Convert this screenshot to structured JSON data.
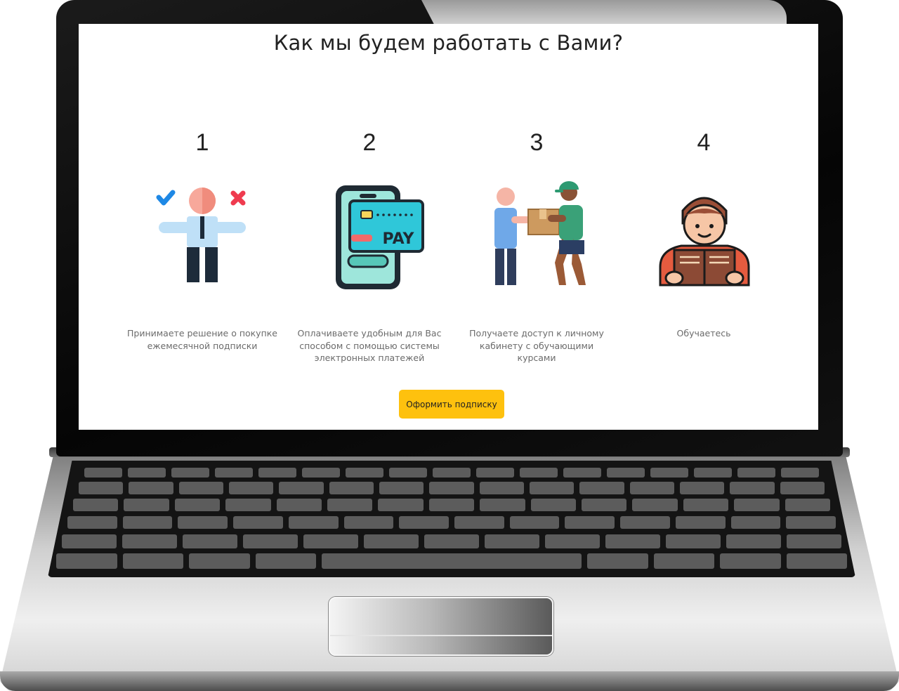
{
  "page": {
    "title": "Как мы будем работать с Вами?"
  },
  "steps": [
    {
      "number": "1",
      "icon": "decision-person-icon",
      "description": "Принимаете решение о покупке ежемесячной подписки"
    },
    {
      "number": "2",
      "icon": "phone-card-pay-icon",
      "description": "Оплачиваете удобным для Вас способом с помощью системы электронных платежей"
    },
    {
      "number": "3",
      "icon": "package-delivery-icon",
      "description": "Получаете доступ к личному кабинету с обучающими курсами"
    },
    {
      "number": "4",
      "icon": "student-reading-icon",
      "description": "Обучаетесь"
    }
  ],
  "pay_card_text": "PAY",
  "cta": {
    "label": "Оформить подписку"
  },
  "colors": {
    "accent": "#fec10e",
    "text": "#222222",
    "muted": "#6b6b6b"
  }
}
